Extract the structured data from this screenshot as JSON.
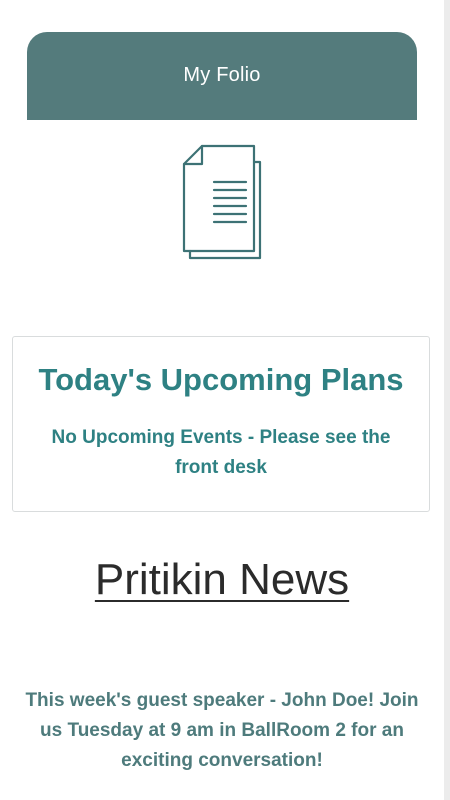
{
  "header": {
    "title": "My Folio"
  },
  "icons": {
    "document": "document-icon"
  },
  "plans": {
    "title": "Today's Upcoming Plans",
    "message": "No Upcoming Events - Please see the front desk"
  },
  "news": {
    "title": "Pritikin News",
    "body": "This week's guest speaker - John Doe! Join us Tuesday at 9 am in BallRoom 2 for an exciting conversation!"
  },
  "colors": {
    "header_bg": "#547b7c",
    "accent": "#2e8183",
    "news_text": "#4e7b7c"
  }
}
